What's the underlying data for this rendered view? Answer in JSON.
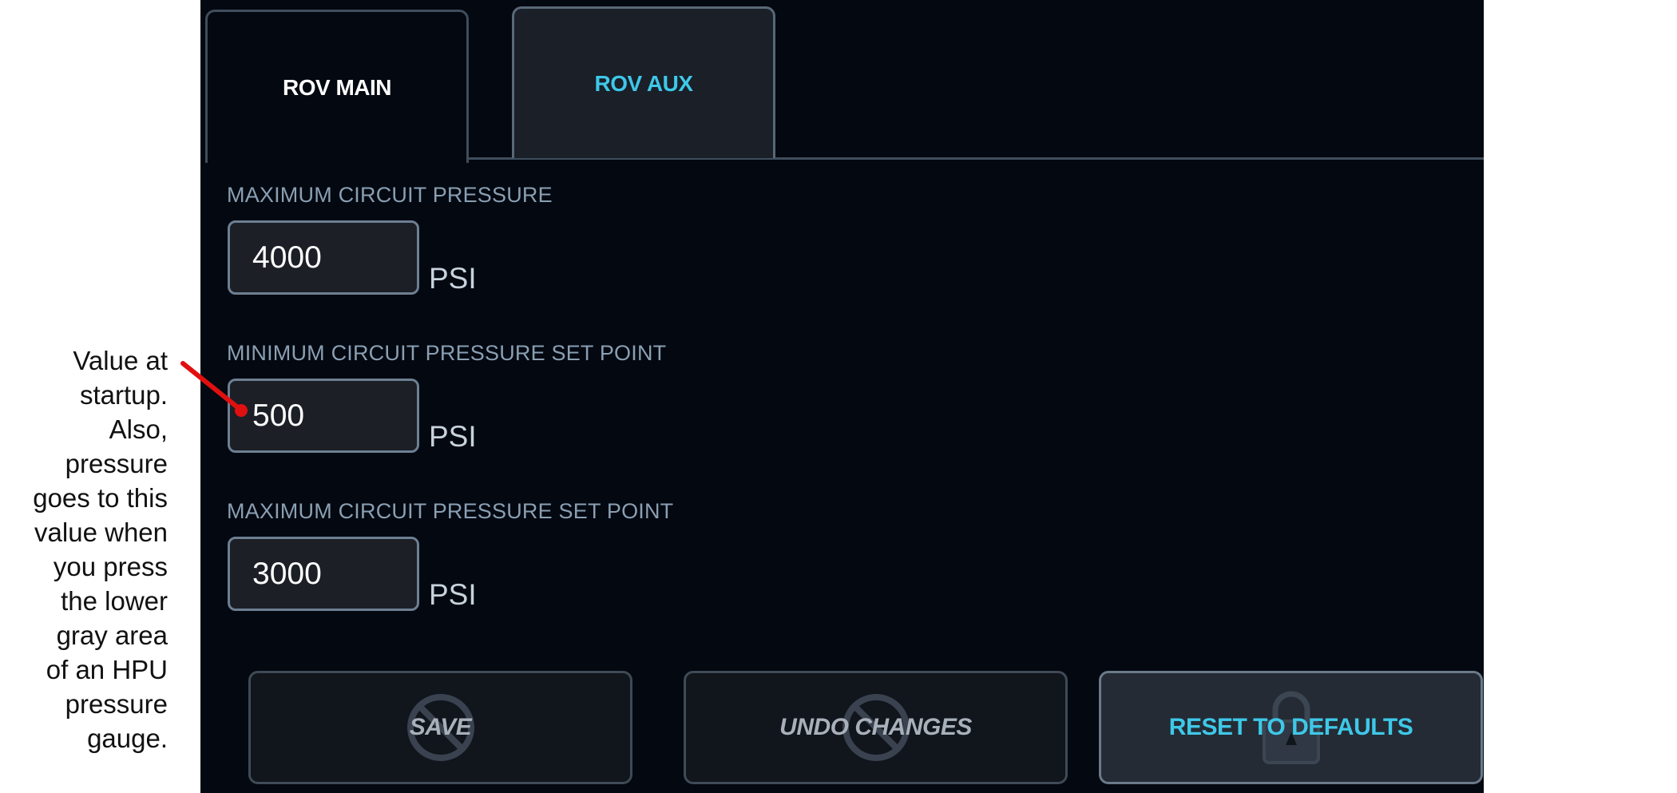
{
  "annotation": {
    "lines": [
      "Value at",
      "startup.",
      "Also,",
      "pressure",
      "goes to this",
      "value when",
      "you press",
      "the lower",
      "gray area",
      "of  an HPU",
      "pressure",
      "gauge."
    ]
  },
  "tabs": [
    {
      "label": "ROV MAIN",
      "active": true
    },
    {
      "label": "ROV AUX",
      "active": false
    }
  ],
  "fields": [
    {
      "label": "MAXIMUM CIRCUIT PRESSURE",
      "value": "4000",
      "unit": "PSI"
    },
    {
      "label": "MINIMUM CIRCUIT PRESSURE SET POINT",
      "value": "500",
      "unit": "PSI"
    },
    {
      "label": "MAXIMUM CIRCUIT PRESSURE SET POINT",
      "value": "3000",
      "unit": "PSI"
    }
  ],
  "buttons": {
    "save": "SAVE",
    "undo": "UNDO CHANGES",
    "reset": "RESET TO DEFAULTS"
  },
  "colors": {
    "panel_bg": "#030811",
    "accent": "#3ec8e8",
    "arrow": "#e01010"
  }
}
